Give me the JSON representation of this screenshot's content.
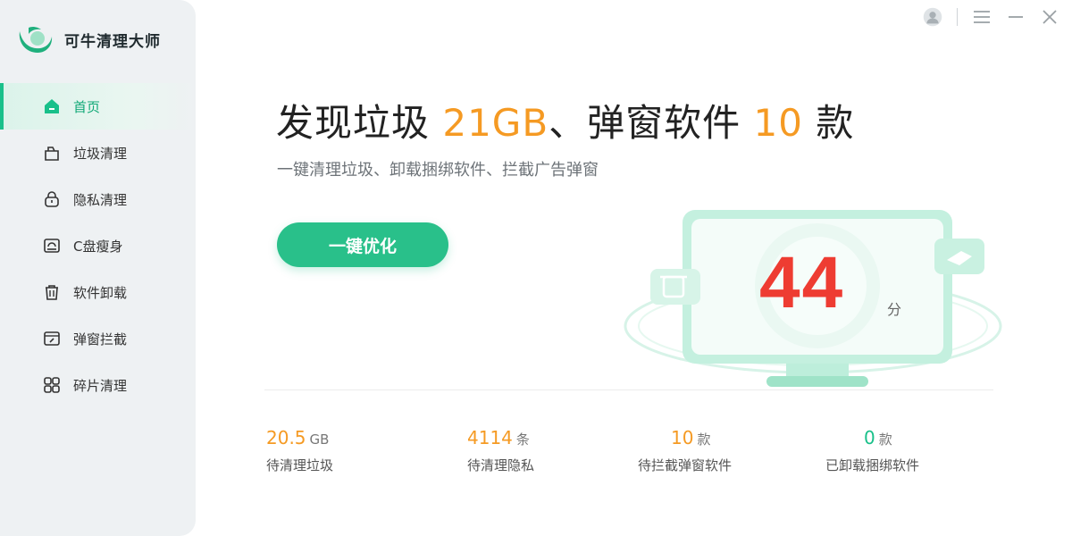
{
  "app": {
    "name": "可牛清理大师"
  },
  "sidebar": {
    "items": [
      {
        "label": "首页",
        "icon": "home-icon",
        "active": true
      },
      {
        "label": "垃圾清理",
        "icon": "trash-bag-icon",
        "active": false
      },
      {
        "label": "隐私清理",
        "icon": "lock-icon",
        "active": false
      },
      {
        "label": "C盘瘦身",
        "icon": "drive-icon",
        "active": false
      },
      {
        "label": "软件卸载",
        "icon": "trash-can-icon",
        "active": false
      },
      {
        "label": "弹窗拦截",
        "icon": "popup-block-icon",
        "active": false
      },
      {
        "label": "碎片清理",
        "icon": "grid-icon",
        "active": false
      }
    ]
  },
  "header": {
    "headline_prefix": "发现垃圾 ",
    "junk_size": "21GB",
    "headline_mid": "、弹窗软件 ",
    "popup_count": "10",
    "headline_suffix": " 款",
    "subtitle": "一键清理垃圾、卸载捆绑软件、拦截广告弹窗",
    "action_button": "一键优化"
  },
  "score": {
    "value": "44",
    "unit": "分"
  },
  "stats": [
    {
      "value": "20.5",
      "unit": "GB",
      "label": "待清理垃圾"
    },
    {
      "value": "4114",
      "unit": "条",
      "label": "待清理隐私"
    },
    {
      "value": "10",
      "unit": "款",
      "label": "待拦截弹窗软件"
    },
    {
      "value": "0",
      "unit": "款",
      "label": "已卸载捆绑软件"
    }
  ],
  "colors": {
    "accent": "#29c08a",
    "highlight": "#f59a23",
    "score": "#ee3c32",
    "sidebar_bg": "#eef1f3"
  }
}
